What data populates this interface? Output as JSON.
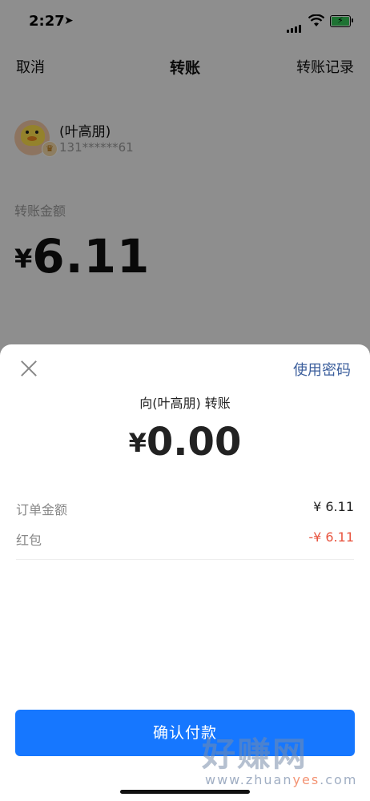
{
  "status_bar": {
    "time": "2:27"
  },
  "nav": {
    "cancel": "取消",
    "title": "转账",
    "records": "转账记录"
  },
  "payee": {
    "name": "(叶高朋)",
    "apple_glyph": "",
    "phone": "131******61"
  },
  "transfer": {
    "amount_label": "转账金额",
    "currency": "¥",
    "amount": "6.11"
  },
  "sheet": {
    "use_password": "使用密码",
    "title": "向(叶高朋) 转账",
    "currency": "¥",
    "amount": "0.00",
    "rows": [
      {
        "label": "订单金额",
        "value": "¥ 6.11"
      },
      {
        "label": "红包",
        "value": "-¥ 6.11"
      }
    ],
    "confirm": "确认付款"
  },
  "watermark": {
    "big": "好赚网",
    "small_prefix": "www.zhuan",
    "small_highlight": "yes",
    "small_suffix": ".com"
  },
  "colors": {
    "accent": "#1677ff",
    "link": "#3b5e9c",
    "discount": "#e8543f"
  },
  "icons": [
    "location-arrow-icon",
    "signal-icon",
    "wifi-icon",
    "battery-charging-icon",
    "close-icon"
  ]
}
